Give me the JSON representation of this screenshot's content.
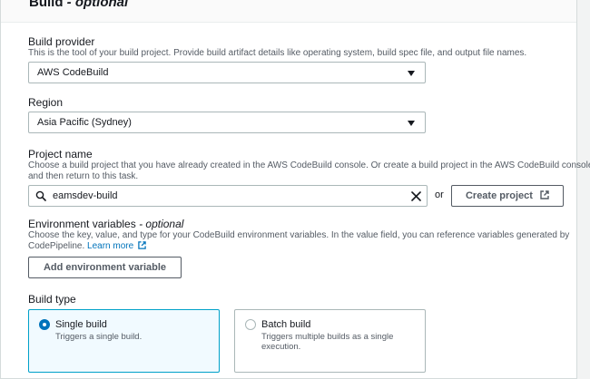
{
  "section": {
    "title": "Build",
    "title_suffix": " - optional"
  },
  "build_provider": {
    "label": "Build provider",
    "description": "This is the tool of your build project. Provide build artifact details like operating system, build spec file, and output file names.",
    "value": "AWS CodeBuild"
  },
  "region": {
    "label": "Region",
    "value": "Asia Pacific (Sydney)"
  },
  "project_name": {
    "label": "Project name",
    "description_line1": "Choose a build project that you have already created in the AWS CodeBuild console. Or create a build project in the AWS CodeBuild console",
    "description_line2": "and then return to this task.",
    "value": "eamsdev-build",
    "or_text": "or",
    "create_label": "Create project"
  },
  "env_vars": {
    "label": "Environment variables",
    "label_suffix": " - optional",
    "description_line1": "Choose the key, value, and type for your CodeBuild environment variables. In the value field, you can reference variables generated by",
    "description_line2": "CodePipeline.",
    "learn_more": "Learn more",
    "add_label": "Add environment variable"
  },
  "build_type": {
    "label": "Build type",
    "options": [
      {
        "title": "Single build",
        "description": "Triggers a single build.",
        "selected": true
      },
      {
        "title": "Batch build",
        "description_line1": "Triggers multiple builds as a single",
        "description_line2": "execution.",
        "selected": false
      }
    ]
  },
  "colors": {
    "accent": "#0073bb",
    "selected_border": "#00a1c9"
  }
}
